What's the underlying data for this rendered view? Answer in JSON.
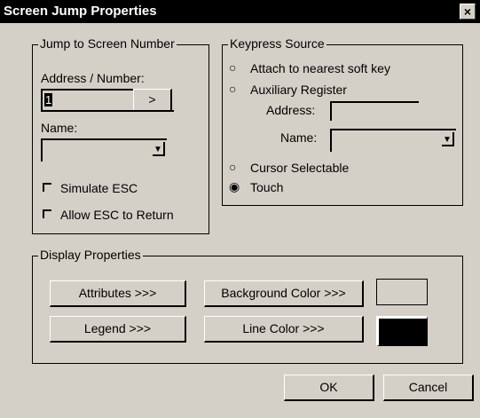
{
  "window": {
    "title": "Screen Jump Properties",
    "close_glyph": "×"
  },
  "jump": {
    "group_label": "Jump to Screen Number",
    "address_label": "Address / Number:",
    "address_value": "1",
    "browse_label": ">",
    "name_label": "Name:",
    "name_value": "",
    "simulate_esc_label": "Simulate ESC",
    "allow_esc_label": "Allow ESC to Return"
  },
  "keypress": {
    "group_label": "Keypress Source",
    "options": [
      {
        "label": "Attach to nearest soft key",
        "selected": false
      },
      {
        "label": "Auxiliary Register",
        "selected": false
      },
      {
        "label": "Cursor Selectable",
        "selected": false
      },
      {
        "label": "Touch",
        "selected": true
      }
    ],
    "address_label": "Address:",
    "address_value": "",
    "name_label": "Name:",
    "name_value": ""
  },
  "display": {
    "group_label": "Display Properties",
    "attributes_label": "Attributes >>>",
    "background_color_label": "Background Color >>>",
    "legend_label": "Legend >>>",
    "line_color_label": "Line Color >>>",
    "background_color": "#d4d0c8",
    "line_color": "#000000"
  },
  "footer": {
    "ok_label": "OK",
    "cancel_label": "Cancel"
  }
}
